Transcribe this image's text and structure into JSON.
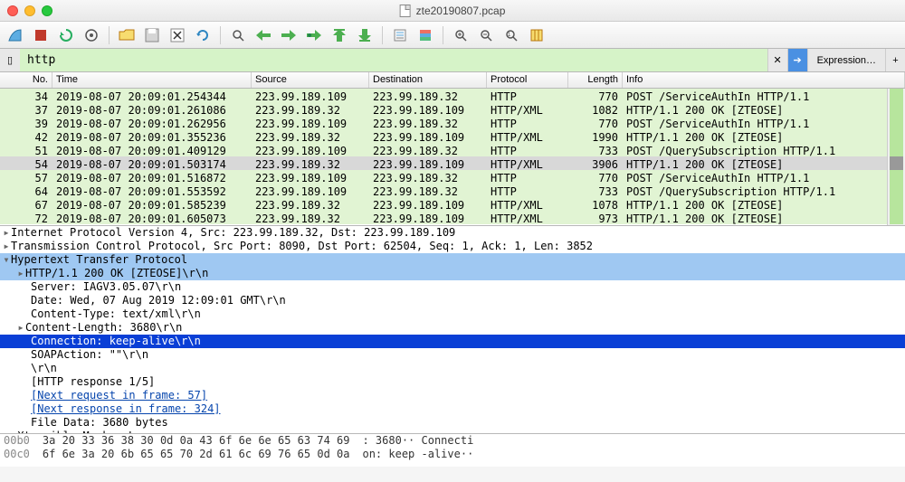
{
  "window": {
    "title": "zte20190807.pcap"
  },
  "filter": {
    "value": "http",
    "clear": "✕",
    "expression": "Expression…",
    "plus": "+"
  },
  "columns": {
    "no": "No.",
    "time": "Time",
    "src": "Source",
    "dst": "Destination",
    "proto": "Protocol",
    "len": "Length",
    "info": "Info"
  },
  "packets": [
    {
      "no": "34",
      "time": "2019-08-07 20:09:01.254344",
      "src": "223.99.189.109",
      "dst": "223.99.189.32",
      "proto": "HTTP",
      "len": "770",
      "info": "POST /ServiceAuthIn HTTP/1.1",
      "cls": "green"
    },
    {
      "no": "37",
      "time": "2019-08-07 20:09:01.261086",
      "src": "223.99.189.32",
      "dst": "223.99.189.109",
      "proto": "HTTP/XML",
      "len": "1082",
      "info": "HTTP/1.1 200 OK [ZTEOSE]",
      "cls": "green"
    },
    {
      "no": "39",
      "time": "2019-08-07 20:09:01.262956",
      "src": "223.99.189.109",
      "dst": "223.99.189.32",
      "proto": "HTTP",
      "len": "770",
      "info": "POST /ServiceAuthIn HTTP/1.1",
      "cls": "green"
    },
    {
      "no": "42",
      "time": "2019-08-07 20:09:01.355236",
      "src": "223.99.189.32",
      "dst": "223.99.189.109",
      "proto": "HTTP/XML",
      "len": "1990",
      "info": "HTTP/1.1 200 OK [ZTEOSE]",
      "cls": "green"
    },
    {
      "no": "51",
      "time": "2019-08-07 20:09:01.409129",
      "src": "223.99.189.109",
      "dst": "223.99.189.32",
      "proto": "HTTP",
      "len": "733",
      "info": "POST /QuerySubscription HTTP/1.1",
      "cls": "green"
    },
    {
      "no": "54",
      "time": "2019-08-07 20:09:01.503174",
      "src": "223.99.189.32",
      "dst": "223.99.189.109",
      "proto": "HTTP/XML",
      "len": "3906",
      "info": "HTTP/1.1 200 OK [ZTEOSE]",
      "cls": "sel"
    },
    {
      "no": "57",
      "time": "2019-08-07 20:09:01.516872",
      "src": "223.99.189.109",
      "dst": "223.99.189.32",
      "proto": "HTTP",
      "len": "770",
      "info": "POST /ServiceAuthIn HTTP/1.1",
      "cls": "green"
    },
    {
      "no": "64",
      "time": "2019-08-07 20:09:01.553592",
      "src": "223.99.189.109",
      "dst": "223.99.189.32",
      "proto": "HTTP",
      "len": "733",
      "info": "POST /QuerySubscription HTTP/1.1",
      "cls": "green"
    },
    {
      "no": "67",
      "time": "2019-08-07 20:09:01.585239",
      "src": "223.99.189.32",
      "dst": "223.99.189.109",
      "proto": "HTTP/XML",
      "len": "1078",
      "info": "HTTP/1.1 200 OK [ZTEOSE]",
      "cls": "green"
    },
    {
      "no": "72",
      "time": "2019-08-07 20:09:01.605073",
      "src": "223.99.189.32",
      "dst": "223.99.189.109",
      "proto": "HTTP/XML",
      "len": "973",
      "info": "HTTP/1.1 200 OK [ZTEOSE]",
      "cls": "green"
    }
  ],
  "details": {
    "ip": "Internet Protocol Version 4, Src: 223.99.189.32, Dst: 223.99.189.109",
    "tcp": "Transmission Control Protocol, Src Port: 8090, Dst Port: 62504, Seq: 1, Ack: 1, Len: 3852",
    "http_label": "Hypertext Transfer Protocol",
    "status": "HTTP/1.1 200 OK [ZTEOSE]\\r\\n",
    "server": "Server: IAGV3.05.07\\r\\n",
    "date": "Date: Wed, 07 Aug 2019 12:09:01 GMT\\r\\n",
    "ctype": "Content-Type: text/xml\\r\\n",
    "clen": "Content-Length: 3680\\r\\n",
    "conn": "Connection: keep-alive\\r\\n",
    "soap": "SOAPAction: \"\"\\r\\n",
    "crlf": "\\r\\n",
    "resp": "[HTTP response 1/5]",
    "nextreq": "[Next request in frame: 57]",
    "nextresp": "[Next response in frame: 324]",
    "filedata": "File Data: 3680 bytes",
    "xml": "eXtensible Markup Language"
  },
  "hex": {
    "r1_off": "00b0",
    "r1_hex": "3a 20 33 36 38 30 0d 0a  43 6f 6e 6e 65 63 74 69",
    "r1_txt": ": 3680·· Connecti",
    "r2_off": "00c0",
    "r2_hex": "6f 6e 3a 20 6b 65 65 70  2d 61 6c 69 76 65 0d 0a",
    "r2_txt": "on: keep -alive··"
  }
}
